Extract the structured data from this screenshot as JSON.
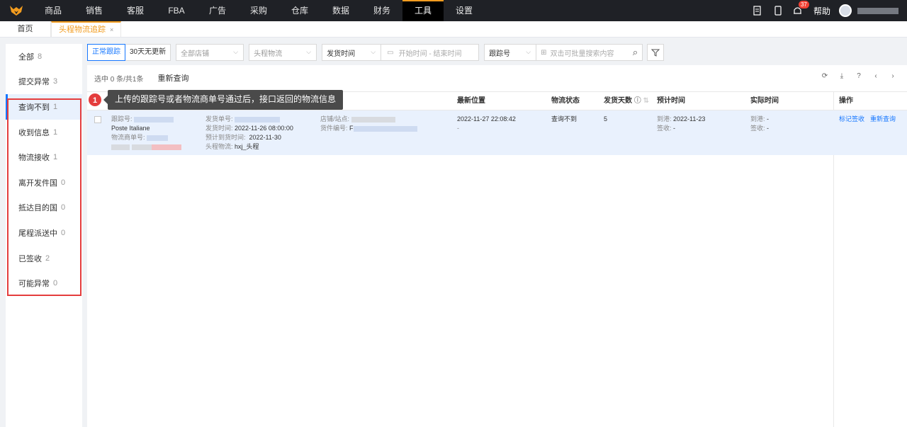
{
  "nav": {
    "items": [
      "商品",
      "销售",
      "客服",
      "FBA",
      "广告",
      "采购",
      "仓库",
      "数据",
      "财务",
      "工具",
      "设置"
    ],
    "active_index": 9,
    "help": "帮助",
    "badge_count": "37"
  },
  "tabs": {
    "home": "首页",
    "active": "头程物流追踪",
    "close": "×"
  },
  "sidebar": {
    "items": [
      {
        "label": "全部",
        "count": "8"
      },
      {
        "label": "提交异常",
        "count": "3"
      },
      {
        "label": "查询不到",
        "count": "1"
      },
      {
        "label": "收到信息",
        "count": "1"
      },
      {
        "label": "物流接收",
        "count": "1"
      },
      {
        "label": "离开发件国",
        "count": "0"
      },
      {
        "label": "抵达目的国",
        "count": "0"
      },
      {
        "label": "尾程派送中",
        "count": "0"
      },
      {
        "label": "已签收",
        "count": "2"
      },
      {
        "label": "可能异常",
        "count": "0"
      }
    ]
  },
  "filters": {
    "seg_on": "正常跟踪",
    "seg_off": "30天无更新",
    "shop": "全部店铺",
    "logistics": "头程物流",
    "date_type": "发货时间",
    "date_range": "开始时间 - 结束时间",
    "search_type": "跟踪号",
    "search_placeholder": "双击可批量搜索内容"
  },
  "toolbar": {
    "selected": "选中 0 条/共1条",
    "requery": "重新查询"
  },
  "table": {
    "headers": {
      "latest": "最新位置",
      "status": "物流状态",
      "days": "发货天数",
      "eta": "预计时间",
      "actual": "实际时间",
      "ops": "操作"
    },
    "row": {
      "track_label": "跟踪号:",
      "carrier": "Poste Italiane",
      "carrier_no_label": "物流商单号:",
      "ship_no_label": "发货单号:",
      "ship_time_label": "发货时间:",
      "ship_time": "2022-11-26 08:00:00",
      "arrive_label": "预计到货时间:",
      "arrive_time": "2022-11-30",
      "logi_label": "头程物流:",
      "logi": "hxj_头程",
      "shop_label": "店铺/站点:",
      "goods_label": "货件编号:",
      "goods_prefix": "F",
      "latest_time": "2022-11-27 22:08:42",
      "latest_place": "-",
      "status": "查询不到",
      "days": "5",
      "eta_port_label": "到港:",
      "eta_port": "2022-11-23",
      "eta_sign_label": "签收:",
      "eta_sign": "-",
      "act_port_label": "到港:",
      "act_port": "-",
      "act_sign_label": "签收:",
      "act_sign": "-",
      "op1": "标记签收",
      "op2": "重新查询"
    }
  },
  "tooltip": {
    "num": "1",
    "text": "上传的跟踪号或者物流商单号通过后，接口返回的物流信息"
  }
}
